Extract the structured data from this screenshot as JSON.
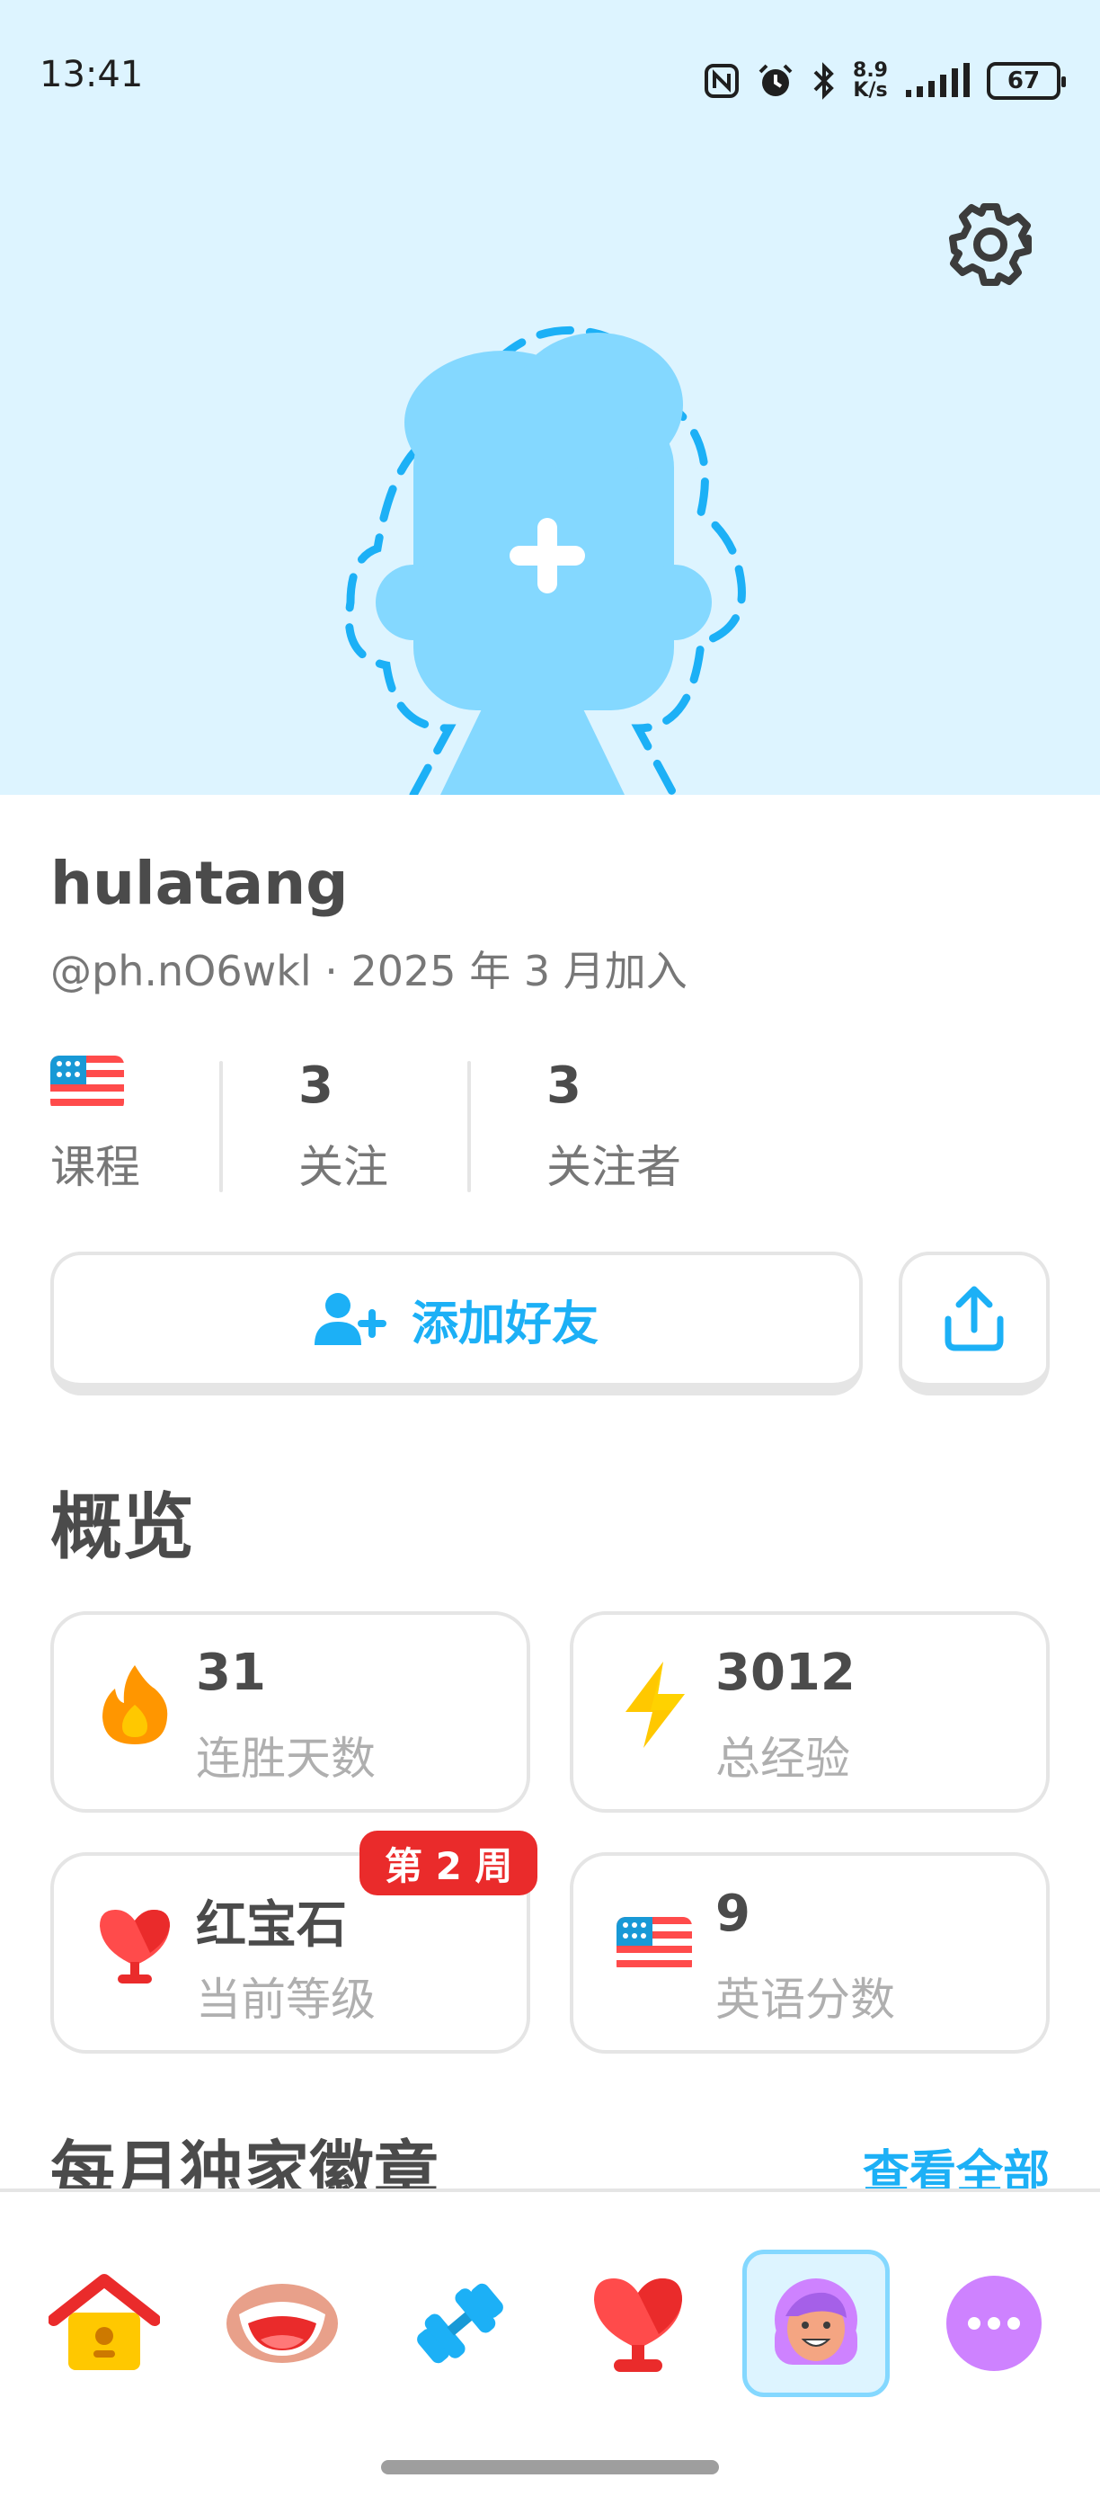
{
  "status_bar": {
    "time": "13:41",
    "network_speed_value": "8.9",
    "network_speed_unit": "K/s",
    "battery": "67",
    "icons": [
      "nfc-icon",
      "alarm-icon",
      "bluetooth-icon",
      "network-speed",
      "signal-icon",
      "battery-icon"
    ]
  },
  "header": {
    "background": "#ddf4ff",
    "settings_icon": "gear-icon",
    "avatar_icon": "add-avatar-placeholder-icon"
  },
  "profile": {
    "display_name": "hulatang",
    "handle_and_join": "@ph.nO6wkl · 2025 年 3 月加入"
  },
  "stats": {
    "course_flag_icon": "us-flag-icon",
    "course_label": "课程",
    "following_count": "3",
    "following_label": "关注",
    "followers_count": "3",
    "followers_label": "关注者"
  },
  "actions": {
    "add_friend_label": "添加好友",
    "add_friend_icon": "add-user-icon",
    "share_icon": "share-icon"
  },
  "overview": {
    "title": "概览",
    "cards": [
      {
        "icon": "fire-icon",
        "value": "31",
        "label": "连胜天数"
      },
      {
        "icon": "lightning-icon",
        "value": "3012",
        "label": "总经验"
      },
      {
        "icon": "ruby-trophy-icon",
        "value": "红宝石",
        "label": "当前等级",
        "badge": "第 2 周"
      },
      {
        "icon": "us-flag-icon",
        "value": "9",
        "label": "英语分数"
      }
    ]
  },
  "badges": {
    "title": "每月独家徽章",
    "view_all": "查看全部"
  },
  "bottom_nav": {
    "items": [
      "home-icon",
      "speaking-mouth-icon",
      "practice-dumbbell-icon",
      "leaderboard-trophy-icon",
      "profile-avatar-icon",
      "more-icon"
    ],
    "active": "profile-avatar-icon"
  },
  "colors": {
    "accent_blue": "#1cb0f6",
    "badge_red": "#ea2b2b",
    "text_dark": "#4b4b4b",
    "text_muted": "#777777",
    "border": "#e5e5e5"
  }
}
